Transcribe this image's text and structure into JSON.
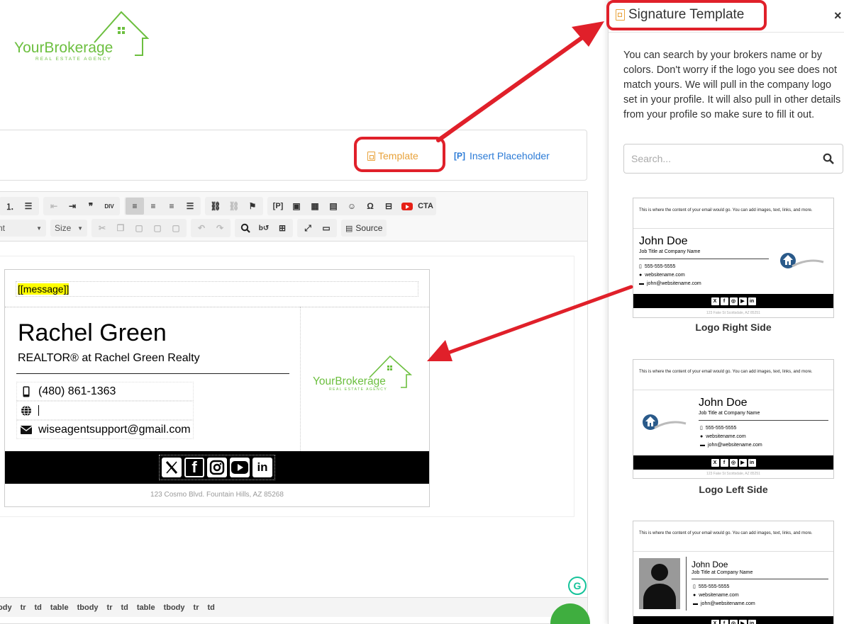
{
  "brand": {
    "name": "YourBrokerage",
    "tagline": "REAL ESTATE AGENCY",
    "color": "#6cbf3f"
  },
  "template_bar": {
    "template_label": "Template",
    "placeholder_tag": "[P]",
    "placeholder_label": "Insert Placeholder"
  },
  "toolbar": {
    "font_combo": "nt",
    "size_combo": "Size",
    "source_label": "Source",
    "buttons": [
      "numbered-list",
      "bulleted-list",
      "outdent",
      "indent",
      "blockquote",
      "div",
      "align-left",
      "align-center",
      "align-right",
      "justify",
      "link",
      "unlink",
      "anchor",
      "placeholder",
      "image",
      "table",
      "horizontal-line",
      "smiley",
      "special-char",
      "page-break",
      "youtube",
      "cta",
      "cut",
      "copy",
      "paste",
      "paste-text",
      "paste-word",
      "undo",
      "redo",
      "find",
      "replace",
      "select-all",
      "maximize",
      "show-blocks"
    ],
    "placeholder_btn": "[P]",
    "div_btn": "DIV",
    "cta_btn": "CTA",
    "quote_btn": "❞",
    "omega_btn": "Ω"
  },
  "signature": {
    "message_tag": "[[message]]",
    "name": "Rachel Green",
    "title": "REALTOR® at Rachel Green Realty",
    "phone": "(480) 861-1363",
    "website": "",
    "email": "wiseagentsupport@gmail.com",
    "address": "123 Cosmo Blvd. Fountain Hills, AZ 85268",
    "social": [
      "X",
      "f",
      "ig",
      "yt",
      "in"
    ]
  },
  "path_bar": [
    "ody",
    "tr",
    "td",
    "table",
    "tbody",
    "tr",
    "td",
    "table",
    "tbody",
    "tr",
    "td"
  ],
  "grammarly_label": "G",
  "panel": {
    "title": "Signature Template",
    "close": "×",
    "description": "You can search by your brokers name or by colors. Don't worry if the logo you see does not match yours. We will pull in the company logo set in your profile. It will also pull in other details from your profile so make sure to fill it out.",
    "search_placeholder": "Search...",
    "templates": [
      {
        "label": "Logo Right Side",
        "message": "This is where the content of your email would go. You can add images, text, links, and more.",
        "name": "John Doe",
        "job": "Job Title at Company Name",
        "phone": "555-555-5555",
        "website": "websitename.com",
        "email": "john@websitename.com",
        "address": "123 Fake St Scottsdale, AZ 85251"
      },
      {
        "label": "Logo Left Side",
        "message": "This is where the content of your email would go. You can add images, text, links, and more.",
        "name": "John Doe",
        "job": "Job Title at Company Name",
        "phone": "555-555-5555",
        "website": "websitename.com",
        "email": "john@websitename.com",
        "address": "123 Fake St Scottsdale, AZ 85251"
      },
      {
        "message": "This is where the content of your email would go. You can add images, text, links, and more.",
        "name": "John Doe",
        "job": "Job Title at Company Name",
        "phone": "555-555-5555",
        "website": "websitename.com",
        "email": "john@websitename.com"
      }
    ]
  },
  "colors": {
    "annotation_red": "#e0202a",
    "template_orange": "#e8a23a",
    "link_blue": "#2a7ad6",
    "fab_green": "#3fae3f"
  }
}
